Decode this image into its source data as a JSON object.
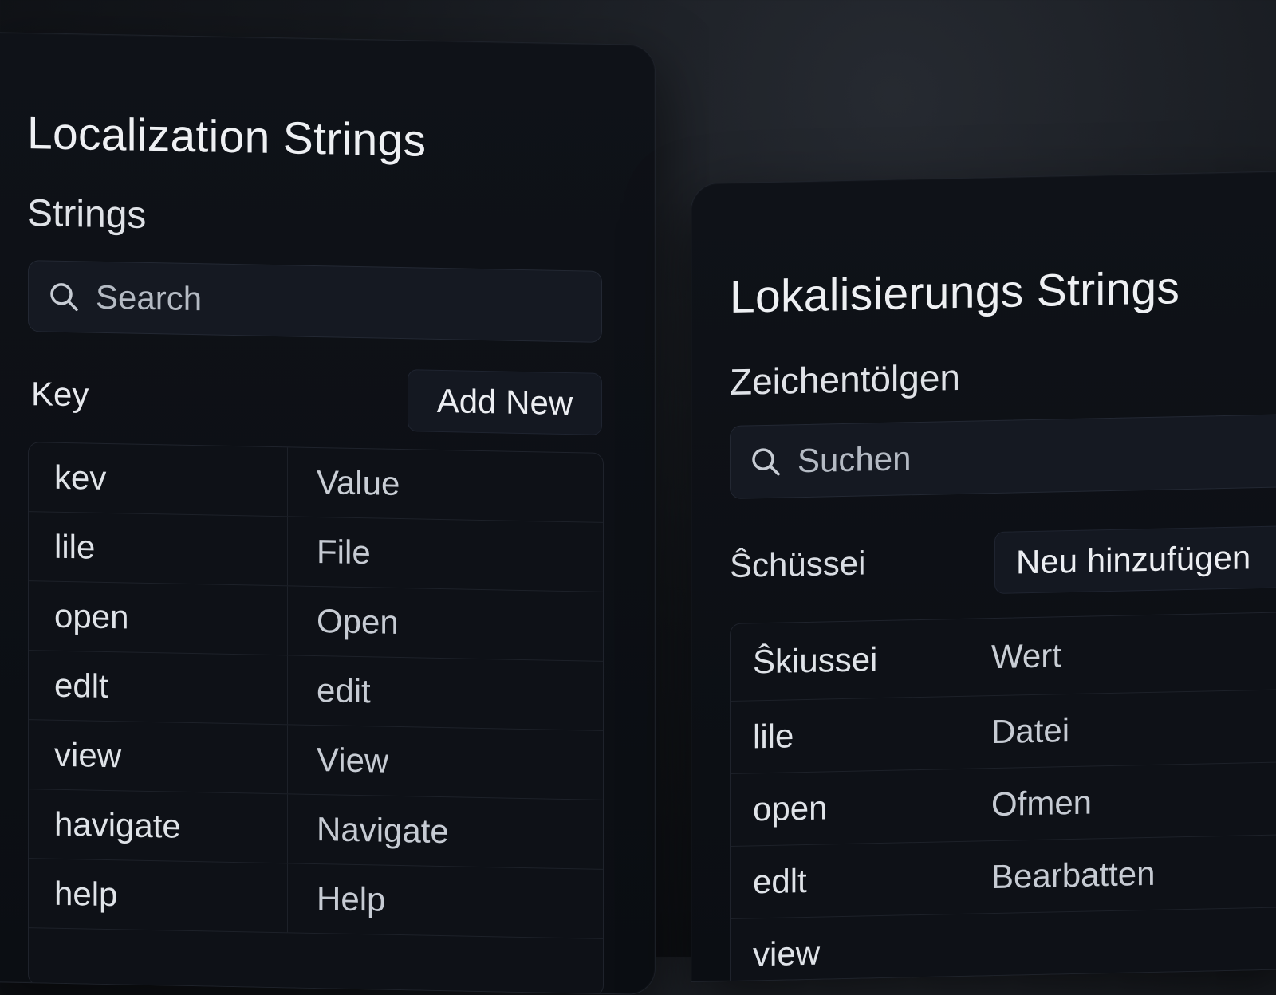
{
  "left_panel": {
    "title": "Localization Strings",
    "subtitle": "Strings",
    "search": {
      "placeholder": "Search",
      "icon": "search-icon"
    },
    "key_label": "Key",
    "add_button_label": "Add New",
    "table": {
      "header": {
        "key": "kev",
        "value": "Value"
      },
      "rows": [
        {
          "key": "lile",
          "value": "File"
        },
        {
          "key": "open",
          "value": "Open"
        },
        {
          "key": "edlt",
          "value": "edit"
        },
        {
          "key": "view",
          "value": "View"
        },
        {
          "key": "havigate",
          "value": "Navigate"
        },
        {
          "key": "help",
          "value": "Help"
        }
      ]
    }
  },
  "right_panel": {
    "title": "Lokalisierungs Strings",
    "subtitle": "Zeichentölgen",
    "search": {
      "placeholder": "Suchen",
      "icon": "search-icon"
    },
    "key_label": "Ŝchüssei",
    "add_button_label": "Neu hinzufügen",
    "table": {
      "header": {
        "key": "Ŝkiussei",
        "value": "Wert"
      },
      "rows": [
        {
          "key": "lile",
          "value": "Datei"
        },
        {
          "key": "open",
          "value": "Ofmen"
        },
        {
          "key": "edlt",
          "value": "Bearbatten"
        },
        {
          "key": "view",
          "value": ""
        }
      ]
    }
  }
}
